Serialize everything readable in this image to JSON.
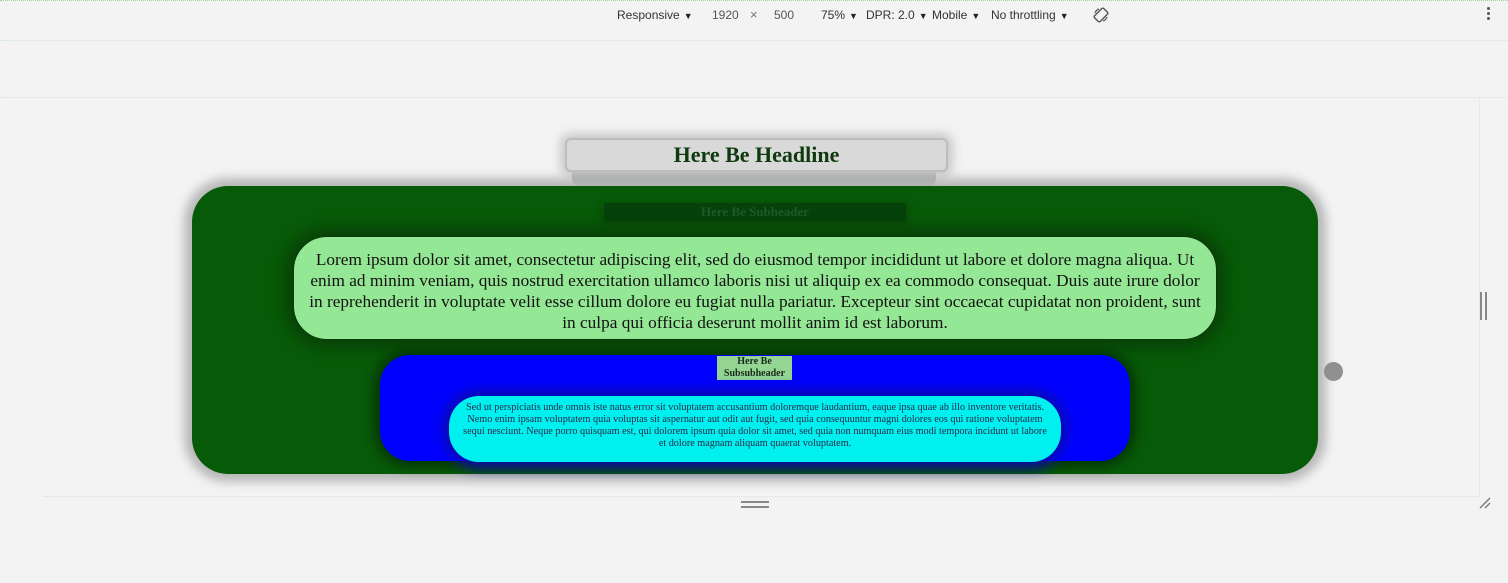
{
  "toolbar": {
    "device": "Responsive",
    "width": "1920",
    "times": "×",
    "height": "500",
    "zoom": "75%",
    "dpr": "DPR: 2.0",
    "mode": "Mobile",
    "throttling": "No throttling"
  },
  "page": {
    "headline": "Here Be Headline",
    "subheader": "Here Be Subheader",
    "lorem": "Lorem ipsum dolor sit amet, consectetur adipiscing elit, sed do eiusmod tempor incididunt ut labore et dolore magna aliqua. Ut enim ad minim veniam, quis nostrud exercitation ullamco laboris nisi ut aliquip ex ea commodo consequat. Duis aute irure dolor in reprehenderit in voluptate velit esse cillum dolore eu fugiat nulla pariatur. Excepteur sint occaecat cupidatat non proident, sunt in culpa qui officia deserunt mollit anim id est laborum.",
    "subsubheader_line1": "Here Be",
    "subsubheader_line2": "Subsubheader",
    "sed": "Sed ut perspiciatis unde omnis iste natus error sit voluptatem accusantium doloremque laudantium, eaque ipsa quae ab illo inventore veritatis. Nemo enim ipsam voluptatem quia voluptas sit aspernatur aut odit aut fugit, sed quia consequuntur magni dolores eos qui ratione voluptatem sequi nesciunt. Neque porro quisquam est, qui dolorem ipsum quia dolor sit amet, sed quia non numquam eius modi tempora incidunt ut labore et dolore magnam aliquam quaerat voluptatem."
  },
  "colors": {
    "outer_card": "#075a07",
    "lorem_box": "#94e794",
    "blue_card": "#0000ff",
    "sed_box": "#00f0f0"
  },
  "icons": {
    "dropdown": "caret-down-icon",
    "rotate": "rotate-icon",
    "more": "more-vertical-icon",
    "resize": "resize-handle-icon"
  }
}
